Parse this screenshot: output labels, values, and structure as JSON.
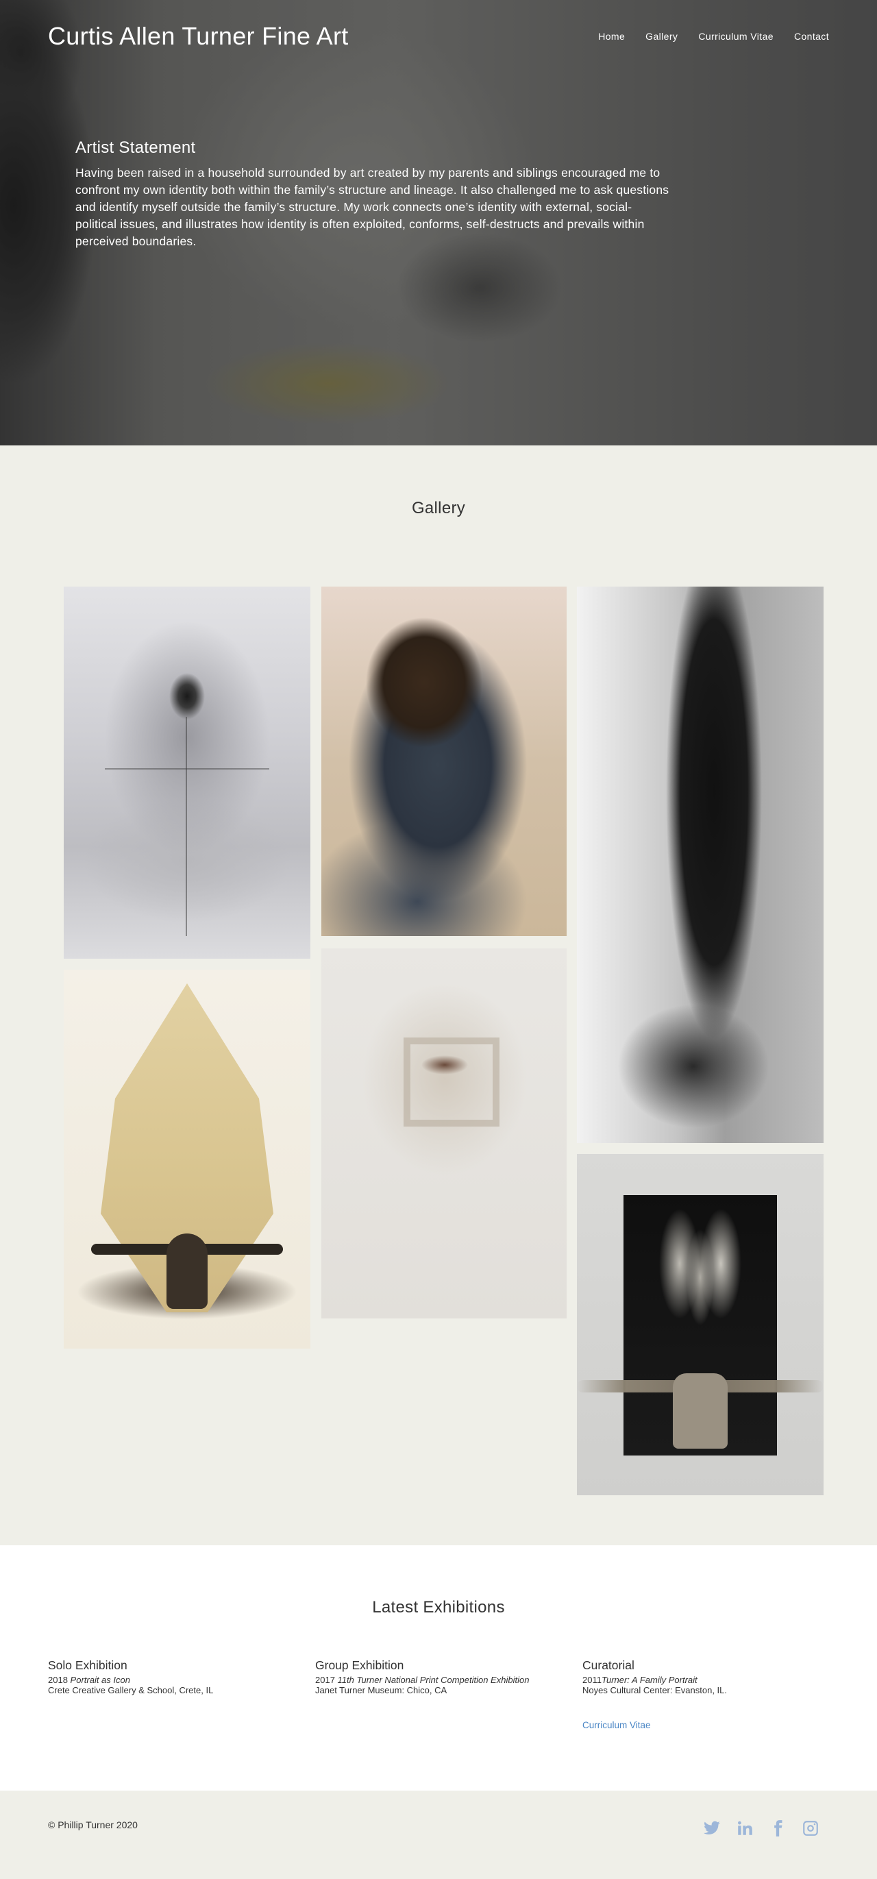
{
  "site": {
    "title": "Curtis Allen Turner Fine Art"
  },
  "nav": {
    "items": [
      {
        "label": "Home"
      },
      {
        "label": "Gallery"
      },
      {
        "label": "Curriculum Vitae"
      },
      {
        "label": "Contact"
      }
    ]
  },
  "statement": {
    "heading": "Artist Statement",
    "body": "Having been raised in a household surrounded by art created by my parents and siblings encouraged me to confront my own identity both within the family’s structure and lineage. It also challenged me to ask questions and identify myself outside the family’s structure. My work connects one’s identity with external, social-political issues, and illustrates how identity is often exploited, conforms, self-destructs and prevails within perceived boundaries."
  },
  "gallery": {
    "heading": "Gallery"
  },
  "exhibitions": {
    "heading": "Latest Exhibitions",
    "solo": {
      "title": "Solo Exhibition",
      "year": "2018 ",
      "work": "Portrait as Icon",
      "venue": "Crete Creative Gallery & School, Crete, IL"
    },
    "group": {
      "title": "Group Exhibition",
      "year": "2017 ",
      "work": "11th Turner National Print Competition Exhibition",
      "venue": "Janet Turner Museum: Chico, CA"
    },
    "curatorial": {
      "title": "Curatorial",
      "year": "2011",
      "work": "Turner: A Family Portrait",
      "venue": "Noyes Cultural Center: Evanston, IL.",
      "link": "Curriculum Vitae"
    }
  },
  "footer": {
    "copyright": "© Phillip Turner 2020",
    "social_icons": [
      "twitter-icon",
      "linkedin-icon",
      "facebook-icon",
      "instagram-icon"
    ],
    "icon_color": "#9cb6d9"
  },
  "colors": {
    "accent_link": "#4a86c5",
    "gallery_bg": "#efefe8"
  }
}
